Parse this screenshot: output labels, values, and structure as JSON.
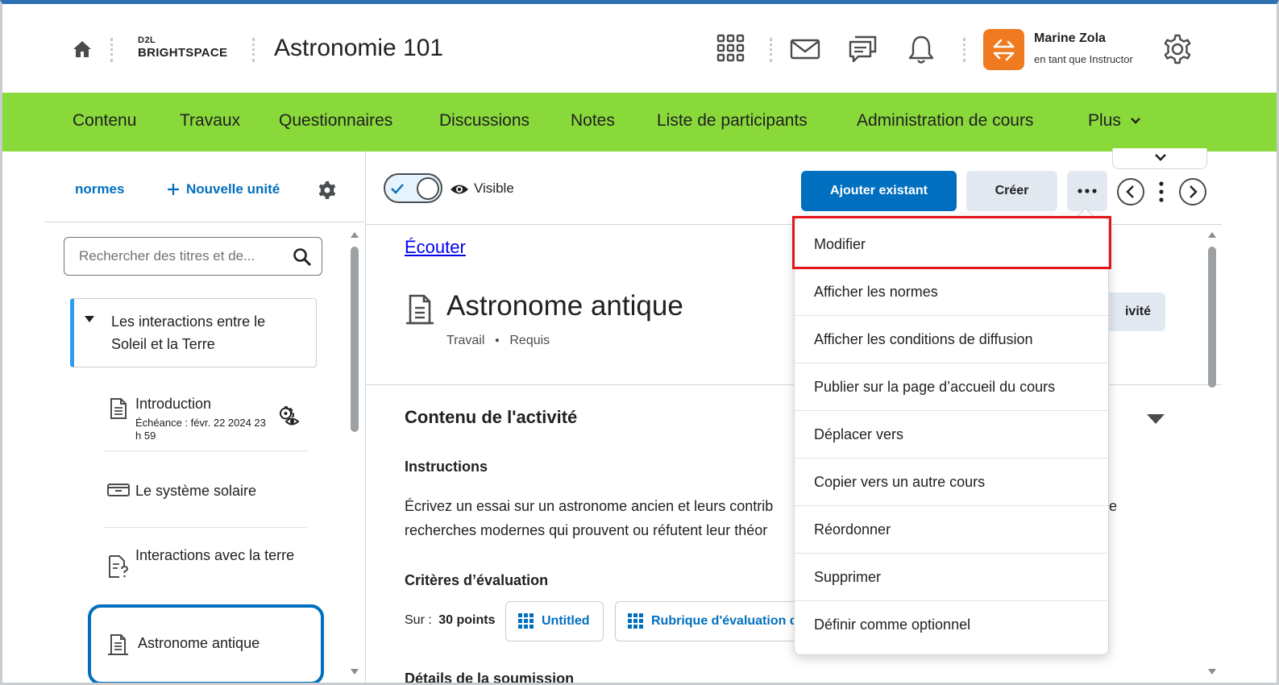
{
  "header": {
    "logo_top": "D2L",
    "logo_bottom": "BRIGHTSPACE",
    "course_title": "Astronomie 101",
    "user_name": "Marine Zola",
    "user_role": "en tant que Instructor",
    "avatar_color": "#f07a20"
  },
  "nav": {
    "bg_color": "#8ad93a",
    "items": [
      "Contenu",
      "Travaux",
      "Questionnaires",
      "Discussions",
      "Notes",
      "Liste de participants",
      "Administration de cours",
      "Plus"
    ]
  },
  "left": {
    "normes_label": "normes",
    "new_unit_label": "Nouvelle unité",
    "search_placeholder": "Rechercher des titres et de...",
    "unit_title": "Les interactions entre le Soleil et la Terre",
    "items": [
      {
        "title": "Introduction",
        "due": "Échéance : févr. 22 2024 23 h 59"
      },
      {
        "title": "Le système solaire"
      },
      {
        "title": "Interactions avec la terre"
      },
      {
        "title": "Astronome antique"
      }
    ]
  },
  "toolbar": {
    "visible_label": "Visible",
    "add_existing_label": "Ajouter existant",
    "create_label": "Créer",
    "more_label": "···"
  },
  "main": {
    "listen_link": "Écouter",
    "activity_title": "Astronome antique",
    "activity_type": "Travail",
    "activity_required": "Requis",
    "activity_button_partial": "ivité",
    "section_title": "Contenu de l'activité",
    "instructions_title": "Instructions",
    "instructions_text_line1": "Écrivez un essai sur un astronome ancien et leurs contrib",
    "instructions_text_line2": "recherches modernes qui prouvent ou réfutent leur théor",
    "instructions_tail": "e",
    "criteria_title": "Critères d’évaluation",
    "out_of_label": "Sur :",
    "points": "30 points",
    "rubric_1": "Untitled",
    "rubric_2": "Rubrique d'évaluation d",
    "details_partial": "Détails de la soumission"
  },
  "menu": {
    "items": [
      "Modifier",
      "Afficher les normes",
      "Afficher les conditions de diffusion",
      "Publier sur la page d’accueil du cours",
      "Déplacer vers",
      "Copier vers un autre cours",
      "Réordonner",
      "Supprimer",
      "Définir comme optionnel"
    ],
    "highlight_color": "#e0161b"
  }
}
